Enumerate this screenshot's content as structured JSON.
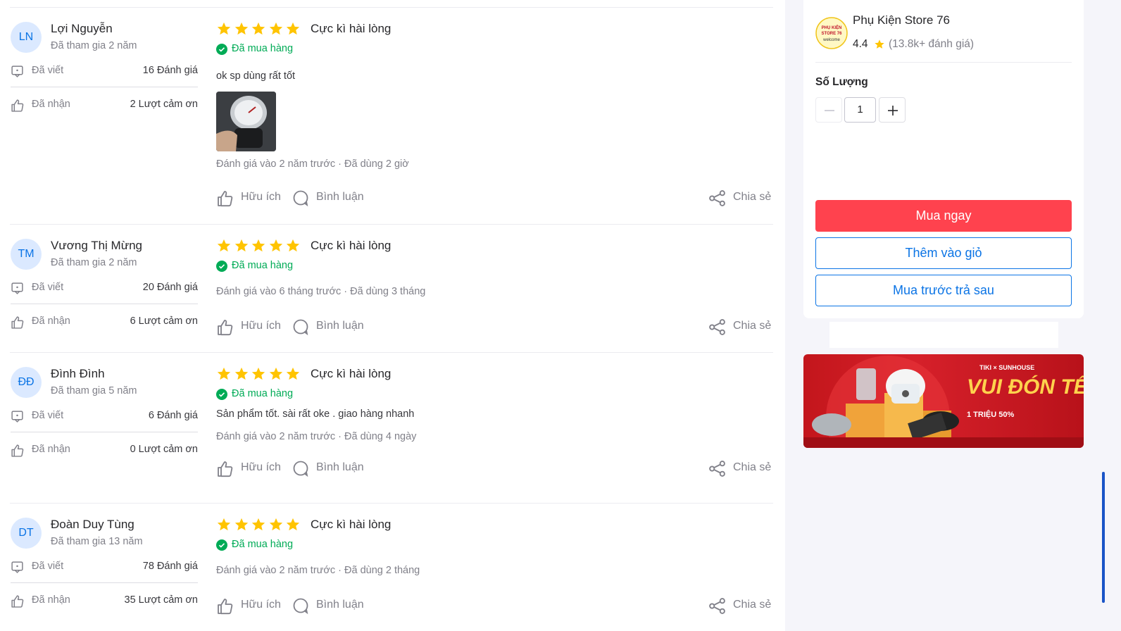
{
  "reviews": [
    {
      "initials": "LN",
      "name": "Lợi Nguyễn",
      "joined": "Đã tham gia 2 năm",
      "written_label": "Đã viết",
      "written_value": "16 Đánh giá",
      "received_label": "Đã nhận",
      "received_value": "2 Lượt cảm ơn",
      "stars": 5,
      "rating_text": "Cực kì hài lòng",
      "bought": "Đã mua hàng",
      "comment": "ok sp dùng rất tốt",
      "has_photo": true,
      "meta": "Đánh giá vào 2 năm trước  ·  Đã dùng 2 giờ",
      "helpful": "Hữu ích",
      "reply": "Bình luận",
      "share": "Chia sẻ"
    },
    {
      "initials": "TM",
      "name": "Vương Thị Mừng",
      "joined": "Đã tham gia 2 năm",
      "written_label": "Đã viết",
      "written_value": "20 Đánh giá",
      "received_label": "Đã nhận",
      "received_value": "6 Lượt cảm ơn",
      "stars": 5,
      "rating_text": "Cực kì hài lòng",
      "bought": "Đã mua hàng",
      "comment": "",
      "has_photo": false,
      "meta": "Đánh giá vào 6 tháng trước  ·  Đã dùng 3 tháng",
      "helpful": "Hữu ích",
      "reply": "Bình luận",
      "share": "Chia sẻ"
    },
    {
      "initials": "ĐĐ",
      "name": "Đình Đình",
      "joined": "Đã tham gia 5 năm",
      "written_label": "Đã viết",
      "written_value": "6 Đánh giá",
      "received_label": "Đã nhận",
      "received_value": "0 Lượt cảm ơn",
      "stars": 5,
      "rating_text": "Cực kì hài lòng",
      "bought": "Đã mua hàng",
      "comment": "Sản phẩm tốt. sài rất oke . giao hàng nhanh",
      "has_photo": false,
      "meta": "Đánh giá vào 2 năm trước  ·  Đã dùng 4 ngày",
      "helpful": "Hữu ích",
      "reply": "Bình luận",
      "share": "Chia sẻ"
    },
    {
      "initials": "DT",
      "name": "Đoàn Duy Tùng",
      "joined": "Đã tham gia 13 năm",
      "written_label": "Đã viết",
      "written_value": "78 Đánh giá",
      "received_label": "Đã nhận",
      "received_value": "35 Lượt cảm ơn",
      "stars": 5,
      "rating_text": "Cực kì hài lòng",
      "bought": "Đã mua hàng",
      "comment": "",
      "has_photo": false,
      "meta": "Đánh giá vào 2 năm trước  ·  Đã dùng 2 tháng",
      "helpful": "Hữu ích",
      "reply": "Bình luận",
      "share": "Chia sẻ"
    }
  ],
  "store": {
    "name": "Phụ Kiện Store 76",
    "logo_text": [
      "PHỤ KIỆN",
      "STORE 76",
      "welcome"
    ],
    "rating": "4.4",
    "rating_count": "(13.8k+ đánh giá)"
  },
  "quantity": {
    "label": "Số Lượng",
    "value": "1"
  },
  "buttons": {
    "buy_now": "Mua ngay",
    "add_to_cart": "Thêm vào giỏ",
    "buy_later": "Mua trước trả sau"
  },
  "banner": {
    "brand": "TIKI × SUNHOUSE",
    "headline": "VUI ĐÓN TẾT Sale",
    "details": "1 TRIỆU   50%"
  },
  "colors": {
    "star": "#ffc400",
    "bought": "#00ab56",
    "primary": "#ff424e",
    "link": "#0b74e5"
  }
}
